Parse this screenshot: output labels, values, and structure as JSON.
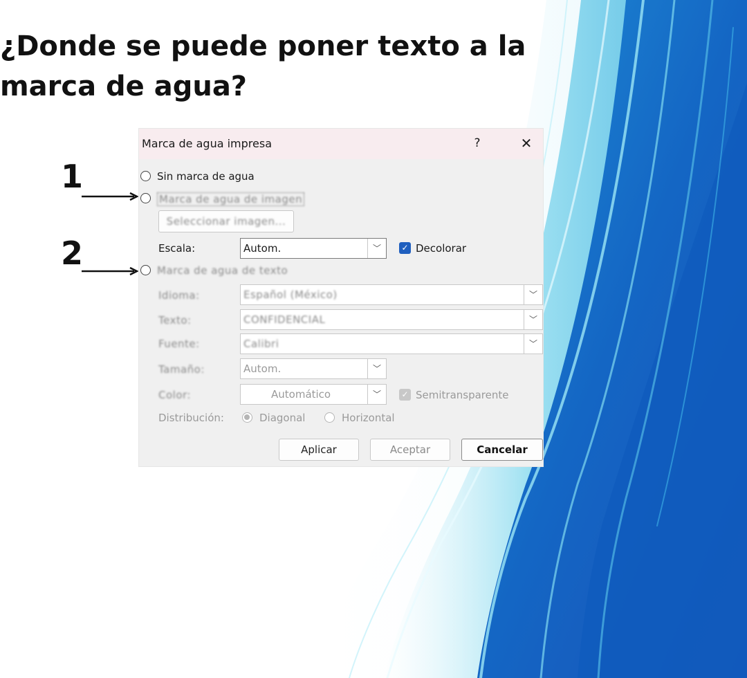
{
  "slide": {
    "title": "¿Donde se puede poner texto a la\nmarca de agua?",
    "marker_1": "1",
    "marker_2": "2"
  },
  "dialog": {
    "title": "Marca de agua impresa",
    "help": "?",
    "close": "✕",
    "no_watermark": "Sin marca de agua",
    "picture_watermark": "Marca de agua de imagen",
    "select_image_button": "Seleccionar imagen...",
    "scale_label": "Escala:",
    "scale_value": "Autom.",
    "washout_label": "Decolorar",
    "text_watermark": "Marca de agua de texto",
    "language_label": "Idioma:",
    "language_value": "Español (México)",
    "text_label": "Texto:",
    "text_value": "CONFIDENCIAL",
    "font_label": "Fuente:",
    "font_value": "Calibri",
    "size_label": "Tamaño:",
    "size_value": "Autom.",
    "color_label": "Color:",
    "color_value": "Automático",
    "semitransparent_label": "Semitransparente",
    "layout_label": "Distribución:",
    "diagonal_label": "Diagonal",
    "horizontal_label": "Horizontal",
    "apply_button": "Aplicar",
    "ok_button": "Aceptar",
    "cancel_button": "Cancelar"
  },
  "icons": {
    "chevron": "chevron-down-icon",
    "check": "check-icon"
  },
  "colors": {
    "checkbox_blue": "#1f5fbf",
    "titlebar": "#f8ecef"
  }
}
